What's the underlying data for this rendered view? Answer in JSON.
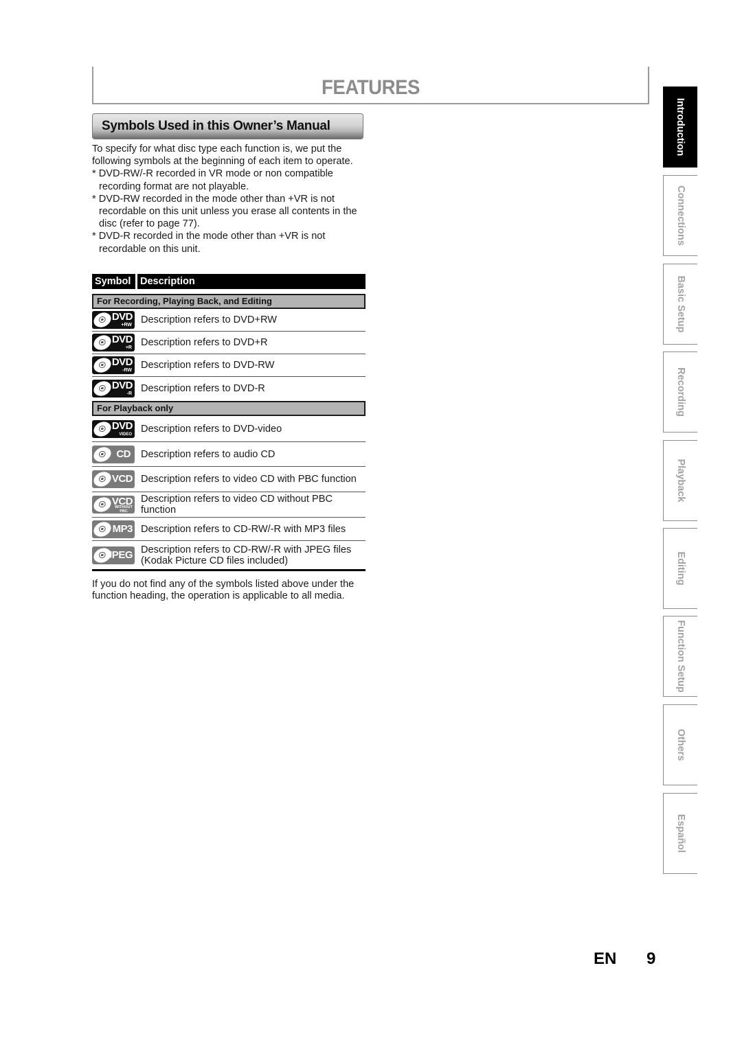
{
  "page_title": "FEATURES",
  "section_heading": "Symbols Used in this Owner’s Manual",
  "intro": {
    "paragraph": "To specify for what disc type each function is, we put the following symbols at the beginning of each item to operate.",
    "notes": [
      "* DVD-RW/-R recorded in VR mode or non compatible recording format are not playable.",
      "* DVD-RW recorded in the mode other than +VR is not recordable on this unit unless you erase all contents in the disc (refer to page 77).",
      "* DVD-R recorded in the mode other than +VR is not recordable on this unit."
    ]
  },
  "table": {
    "headers": [
      "Symbol",
      "Description"
    ],
    "groups": [
      {
        "label": "For Recording, Playing Back, and Editing",
        "rows": [
          {
            "icon": "dvd-plus-rw-icon",
            "icon_label": "DVD",
            "icon_sub": "+RW",
            "description": "Description refers to DVD+RW"
          },
          {
            "icon": "dvd-plus-r-icon",
            "icon_label": "DVD",
            "icon_sub": "+R",
            "description": "Description refers to DVD+R"
          },
          {
            "icon": "dvd-minus-rw-icon",
            "icon_label": "DVD",
            "icon_sub": "-RW",
            "description": "Description refers to DVD-RW"
          },
          {
            "icon": "dvd-minus-r-icon",
            "icon_label": "DVD",
            "icon_sub": "-R",
            "description": "Description refers to DVD-R"
          }
        ]
      },
      {
        "label": "For Playback only",
        "rows": [
          {
            "icon": "dvd-video-icon",
            "icon_label": "DVD",
            "icon_sub": "VIDEO",
            "description": "Description refers to DVD-video"
          },
          {
            "icon": "cd-icon",
            "icon_label": "CD",
            "icon_sub": "",
            "description": "Description refers to audio CD"
          },
          {
            "icon": "vcd-icon",
            "icon_label": "VCD",
            "icon_sub": "",
            "description": "Description refers to video CD with PBC function"
          },
          {
            "icon": "vcd-without-pbc-icon",
            "icon_label": "VCD",
            "icon_sub": "WITHOUT PBC",
            "description": "Description refers to video CD without PBC function"
          },
          {
            "icon": "mp3-icon",
            "icon_label": "MP3",
            "icon_sub": "",
            "description": "Description refers to CD-RW/-R with MP3 files"
          },
          {
            "icon": "jpeg-icon",
            "icon_label": "JPEG",
            "icon_sub": "",
            "description": "Description refers to CD-RW/-R with JPEG files (Kodak Picture CD files included)"
          }
        ]
      }
    ]
  },
  "footnote": "If you do not find any of the symbols listed above under the function heading, the operation is applicable to all media.",
  "side_tabs": [
    {
      "label": "Introduction",
      "active": true
    },
    {
      "label": "Connections",
      "active": false
    },
    {
      "label": "Basic Setup",
      "active": false
    },
    {
      "label": "Recording",
      "active": false
    },
    {
      "label": "Playback",
      "active": false
    },
    {
      "label": "Editing",
      "active": false
    },
    {
      "label": "Function Setup",
      "active": false
    },
    {
      "label": "Others",
      "active": false
    },
    {
      "label": "Español",
      "active": false
    }
  ],
  "footer": {
    "language": "EN",
    "page_number": "9"
  }
}
